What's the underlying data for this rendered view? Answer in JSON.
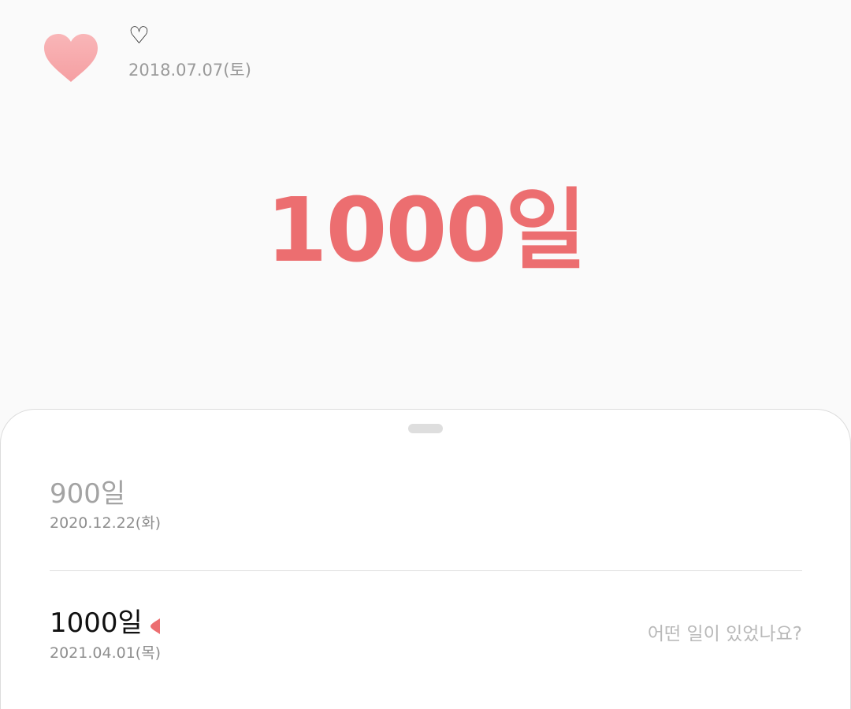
{
  "header": {
    "logo_icon": "heart-icon",
    "title_symbol": "♡",
    "start_date": "2018.07.07(토)"
  },
  "counter": {
    "value_text": "1000일",
    "color": "#ec6e70"
  },
  "milestones": [
    {
      "count": "900일",
      "date": "2020.12.22(화)",
      "state": "past"
    },
    {
      "count": "1000일",
      "date": "2021.04.01(목)",
      "state": "current",
      "marker_icon": "pointer-marker-icon",
      "memo_placeholder": "어떤 일이 있었나요?"
    }
  ],
  "colors": {
    "accent": "#ec6e70",
    "heart": "#f7aeb0",
    "background": "#fafafa",
    "sheet": "#ffffff"
  }
}
